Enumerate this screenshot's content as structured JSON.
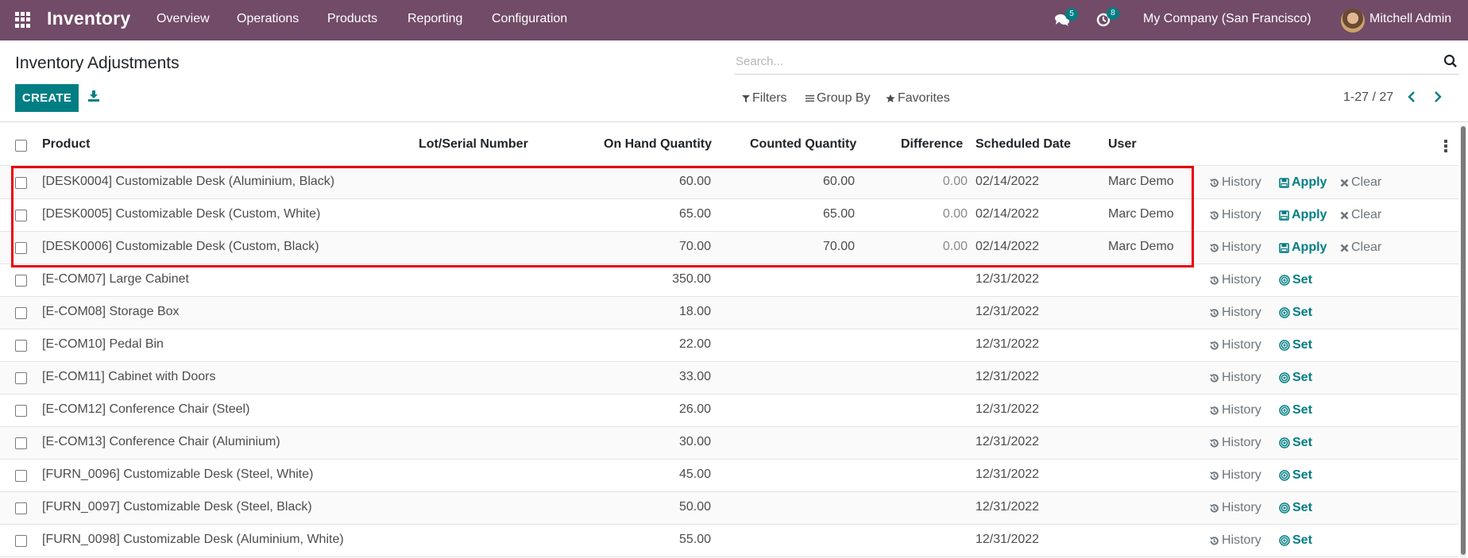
{
  "navbar": {
    "app_icon": "apps-grid-icon",
    "brand": "Inventory",
    "menus": [
      "Overview",
      "Operations",
      "Products",
      "Reporting",
      "Configuration"
    ],
    "messages_icon": "chat-bubbles-icon",
    "messages_count": "5",
    "activities_icon": "clock-icon",
    "activities_count": "8",
    "company": "My Company (San Francisco)",
    "user": "Mitchell Admin"
  },
  "control_panel": {
    "title": "Inventory Adjustments",
    "create_label": "CREATE",
    "download_icon": "download-icon",
    "search_placeholder": "Search...",
    "filters_label": "Filters",
    "group_by_label": "Group By",
    "favorites_label": "Favorites",
    "pager": "1-27 / 27"
  },
  "colors": {
    "navbar": "#714B67",
    "primary": "#017e84",
    "highlight": "#e8000b"
  },
  "table": {
    "columns": [
      "Product",
      "Lot/Serial Number",
      "On Hand Quantity",
      "Counted Quantity",
      "Difference",
      "Scheduled Date",
      "User"
    ],
    "actions": {
      "history": "History",
      "apply": "Apply",
      "clear": "Clear",
      "set": "Set"
    },
    "rows": [
      {
        "product": "[DESK0004] Customizable Desk (Aluminium, Black)",
        "lot": "",
        "on_hand": "60.00",
        "counted": "60.00",
        "difference": "0.00",
        "date": "02/14/2022",
        "user": "Marc Demo",
        "mode": "apply"
      },
      {
        "product": "[DESK0005] Customizable Desk (Custom, White)",
        "lot": "",
        "on_hand": "65.00",
        "counted": "65.00",
        "difference": "0.00",
        "date": "02/14/2022",
        "user": "Marc Demo",
        "mode": "apply"
      },
      {
        "product": "[DESK0006] Customizable Desk (Custom, Black)",
        "lot": "",
        "on_hand": "70.00",
        "counted": "70.00",
        "difference": "0.00",
        "date": "02/14/2022",
        "user": "Marc Demo",
        "mode": "apply"
      },
      {
        "product": "[E-COM07] Large Cabinet",
        "lot": "",
        "on_hand": "350.00",
        "counted": "",
        "difference": "",
        "date": "12/31/2022",
        "user": "",
        "mode": "set"
      },
      {
        "product": "[E-COM08] Storage Box",
        "lot": "",
        "on_hand": "18.00",
        "counted": "",
        "difference": "",
        "date": "12/31/2022",
        "user": "",
        "mode": "set"
      },
      {
        "product": "[E-COM10] Pedal Bin",
        "lot": "",
        "on_hand": "22.00",
        "counted": "",
        "difference": "",
        "date": "12/31/2022",
        "user": "",
        "mode": "set"
      },
      {
        "product": "[E-COM11] Cabinet with Doors",
        "lot": "",
        "on_hand": "33.00",
        "counted": "",
        "difference": "",
        "date": "12/31/2022",
        "user": "",
        "mode": "set"
      },
      {
        "product": "[E-COM12] Conference Chair (Steel)",
        "lot": "",
        "on_hand": "26.00",
        "counted": "",
        "difference": "",
        "date": "12/31/2022",
        "user": "",
        "mode": "set"
      },
      {
        "product": "[E-COM13] Conference Chair (Aluminium)",
        "lot": "",
        "on_hand": "30.00",
        "counted": "",
        "difference": "",
        "date": "12/31/2022",
        "user": "",
        "mode": "set"
      },
      {
        "product": "[FURN_0096] Customizable Desk (Steel, White)",
        "lot": "",
        "on_hand": "45.00",
        "counted": "",
        "difference": "",
        "date": "12/31/2022",
        "user": "",
        "mode": "set"
      },
      {
        "product": "[FURN_0097] Customizable Desk (Steel, Black)",
        "lot": "",
        "on_hand": "50.00",
        "counted": "",
        "difference": "",
        "date": "12/31/2022",
        "user": "",
        "mode": "set"
      },
      {
        "product": "[FURN_0098] Customizable Desk (Aluminium, White)",
        "lot": "",
        "on_hand": "55.00",
        "counted": "",
        "difference": "",
        "date": "12/31/2022",
        "user": "",
        "mode": "set"
      }
    ]
  }
}
